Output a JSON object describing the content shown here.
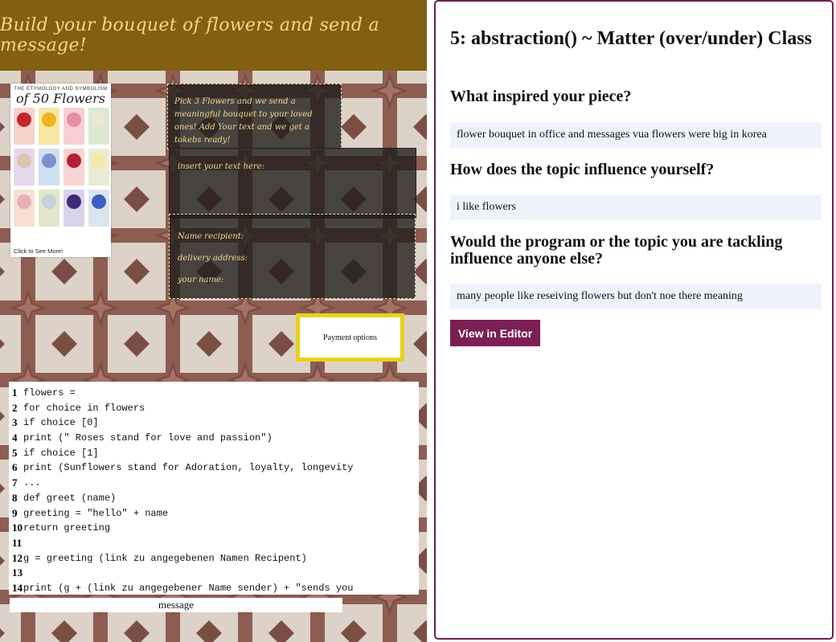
{
  "artwork": {
    "banner_text": "Build your bouquet of flowers and send a message!",
    "poster": {
      "title": "THE ETYMOLOGY AND SYMBOLISM",
      "subtitle": "of 50 Flowers",
      "cta": "Click to See More!",
      "cell_colors": [
        "#f5d3c9",
        "#f8e6a3",
        "#f7cfd4",
        "#dce9d2",
        "#e6d8ea",
        "#cfe0f1",
        "#f7d3d3",
        "#e9ecd5",
        "#f7e0d2",
        "#dfe6c9",
        "#d8d3ea",
        "#d9e6f0"
      ],
      "flower_colors": [
        "#c4262d",
        "#f2b21e",
        "#e98ea0",
        "#ece6d2",
        "#d9c5b2",
        "#7c8fcf",
        "#b02034",
        "#f4e8a8",
        "#e7b0b6",
        "#c8cfd9",
        "#3c2a7a",
        "#3b5ec4"
      ]
    },
    "intro_text": "Pick 3 Flowers and we send a meaningful bouquet to your loved ones! Add Your text and we get a tokebs ready!",
    "text_label": "insert your text here:",
    "recipient_labels": [
      "Name recipient:",
      "delivery address:",
      "your name:"
    ],
    "payment_button": "Payment options",
    "code_lines": [
      {
        "n": "1",
        "t": "flowers ="
      },
      {
        "n": "2",
        "t": "for choice in flowers"
      },
      {
        "n": "3",
        "t": " if choice [0]"
      },
      {
        "n": "4",
        "t": "print (\" Roses stand for love and passion\")"
      },
      {
        "n": "5",
        "t": " if choice [1]"
      },
      {
        "n": "6",
        "t": "print (Sunflowers stand for Adoration, loyalty, longevity"
      },
      {
        "n": "7",
        "t": "..."
      },
      {
        "n": "8",
        "t": "def greet (name)"
      },
      {
        "n": "9",
        "t": "greeting = \"hello\" + name"
      },
      {
        "n": "10",
        "t": "return greeting"
      },
      {
        "n": "11",
        "t": ""
      },
      {
        "n": "12",
        "t": "g = greeting (link zu angegebenen Namen Recipent)"
      },
      {
        "n": "13",
        "t": ""
      },
      {
        "n": "14",
        "t": "print (g + (link zu angegebener Name sender) + \"sends you"
      }
    ],
    "message_label": "message"
  },
  "info": {
    "title": "5: abstraction() ~ Matter (over/under) Class",
    "q1": "What inspired your piece?",
    "a1": "flower bouquet in office and messages vua flowers were big in korea",
    "q2": "How does the topic influence yourself?",
    "a2": "i like flowers",
    "q3": "Would the program or the topic you are tackling influence anyone else?",
    "a3": "many people like reseiving flowers but don't noe there meaning",
    "editor_button": "View in Editor"
  }
}
